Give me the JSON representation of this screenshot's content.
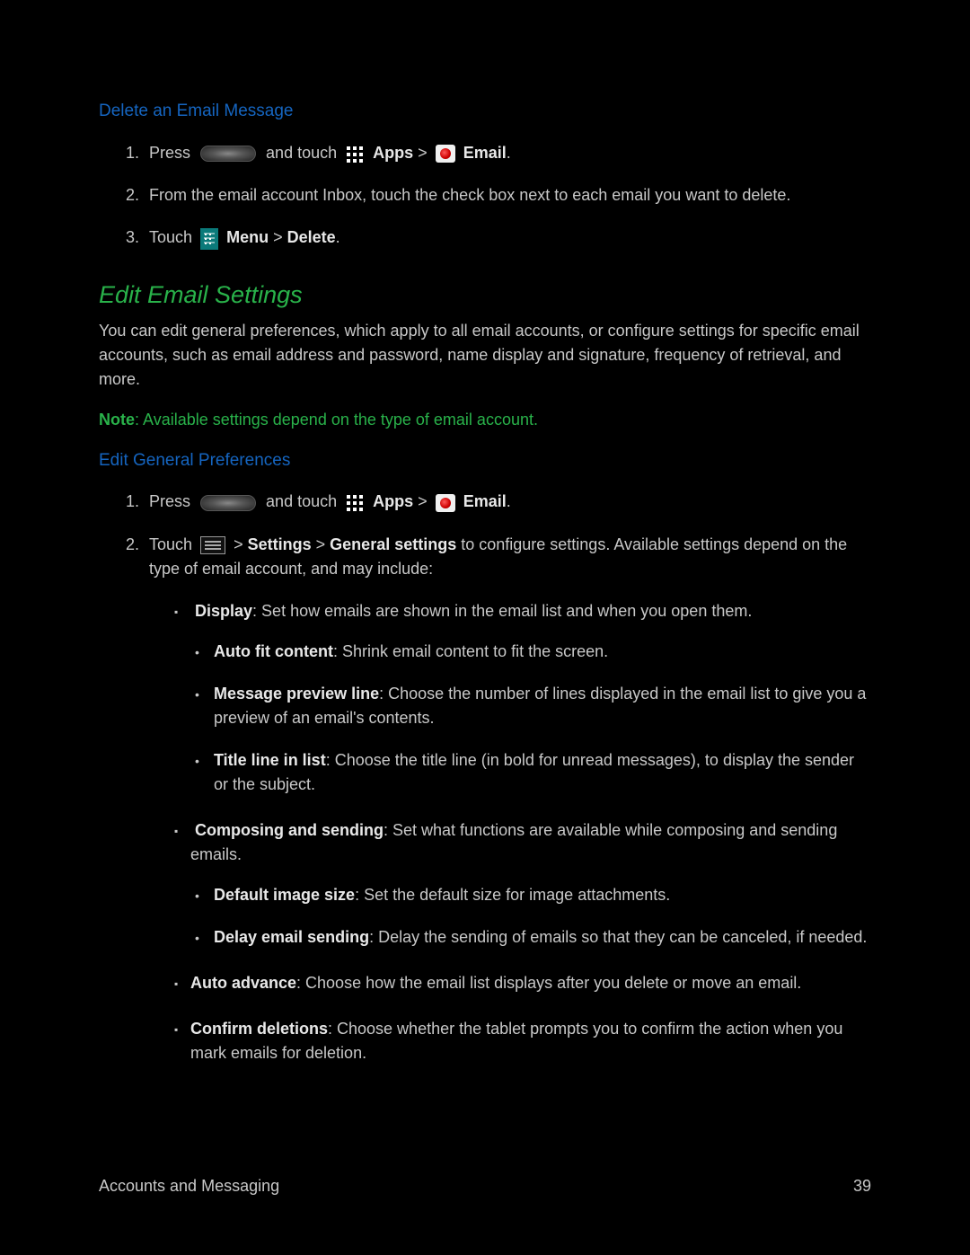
{
  "section1": {
    "title": "Delete an Email Message",
    "step1": {
      "pre": "Press",
      "mid": "and touch",
      "apps": "Apps",
      "gt": ">",
      "email": "Email",
      "dot": "."
    },
    "step2": "From the email account Inbox, touch the check box next to each email you want to delete.",
    "step3": {
      "pre": "Touch",
      "menu": "Menu",
      "gt": ">",
      "delete": "Delete",
      "dot": "."
    }
  },
  "section2": {
    "title": "Edit Email Settings",
    "para": "You can edit general preferences, which apply to all email accounts, or configure settings for specific email accounts, such as email address and password, name display and signature, frequency of retrieval, and more.",
    "note": {
      "label": "Note",
      "text": ": Available settings depend on the type of email account."
    }
  },
  "section3": {
    "title": "Edit General Preferences",
    "step1": {
      "pre": "Press",
      "mid": "and touch",
      "apps": "Apps",
      "gt": ">",
      "email": "Email",
      "dot": "."
    },
    "step2": {
      "pre": "Touch",
      "gt1": ">",
      "settings": "Settings",
      "gt2": ">",
      "general": "General settings",
      "rest": " to configure settings. Available settings depend on the type of email account, and may include:"
    },
    "display": {
      "title": "Display",
      "text": ": Set how emails are shown in the email list and when you open them.",
      "auto_fit": {
        "title": "Auto fit content",
        "text": ": Shrink email content to fit the screen."
      },
      "preview": {
        "title": "Message preview line",
        "text": ": Choose the number of lines displayed in the email list to give you a preview of an email's contents."
      },
      "titleline": {
        "title": "Title line in list",
        "text": ": Choose the title line (in bold for unread messages), to display the sender or the subject."
      }
    },
    "composing": {
      "title": "Composing and sending",
      "text": ": Set what functions are available while composing and sending emails.",
      "img_size": {
        "title": "Default image size",
        "text": ": Set the default size for image attachments."
      },
      "delay": {
        "title": "Delay email sending",
        "text": ": Delay the sending of emails so that they can be canceled, if needed."
      }
    },
    "auto_advance": {
      "title": "Auto advance",
      "text": ": Choose how the email list displays after you delete or move an email."
    },
    "confirm": {
      "title": "Confirm deletions",
      "text": ": Choose whether the tablet prompts you to confirm the action when you mark emails for deletion."
    }
  },
  "footer": {
    "left": "Accounts and Messaging",
    "right": "39"
  }
}
